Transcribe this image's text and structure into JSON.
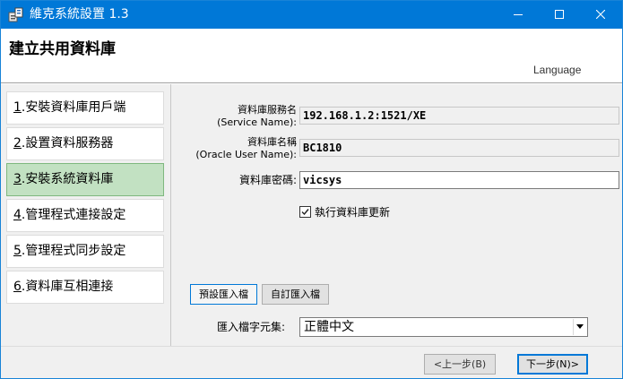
{
  "window": {
    "title": "維克系統設置 1.3",
    "accent_color": "#0078d7",
    "icons": [
      "app-icon",
      "minimize-icon",
      "maximize-icon",
      "close-icon"
    ]
  },
  "header": {
    "title": "建立共用資料庫",
    "language_link": "Language"
  },
  "steps": [
    {
      "num": "1",
      "label": ".安裝資料庫用戶端",
      "active": false
    },
    {
      "num": "2",
      "label": ".設置資料服務器",
      "active": false
    },
    {
      "num": "3",
      "label": ".安裝系統資料庫",
      "active": true
    },
    {
      "num": "4",
      "label": ".管理程式連接設定",
      "active": false
    },
    {
      "num": "5",
      "label": ".管理程式同步設定",
      "active": false
    },
    {
      "num": "6",
      "label": ".資料庫互相連接",
      "active": false
    }
  ],
  "form": {
    "service_name_label_1": "資料庫服務名",
    "service_name_label_2": "(Service Name):",
    "service_name_value": "192.168.1.2:1521/XE",
    "user_name_label_1": "資料庫名稱",
    "user_name_label_2": "(Oracle User Name):",
    "user_name_value": "BC1810",
    "password_label": "資料庫密碼:",
    "password_value": "vicsys",
    "update_checkbox_label": "執行資料庫更新",
    "update_checked": true
  },
  "import": {
    "tab_preset": "預設匯入檔",
    "tab_custom": "自訂匯入檔",
    "charset_label": "匯入檔字元集:",
    "charset_value": "正體中文"
  },
  "footer": {
    "prev_button": "<上一步(B)",
    "next_button": "下一步(N)>"
  },
  "colors": {
    "active_step_bg": "#c2e1c2",
    "titlebar": "#0078d7"
  }
}
